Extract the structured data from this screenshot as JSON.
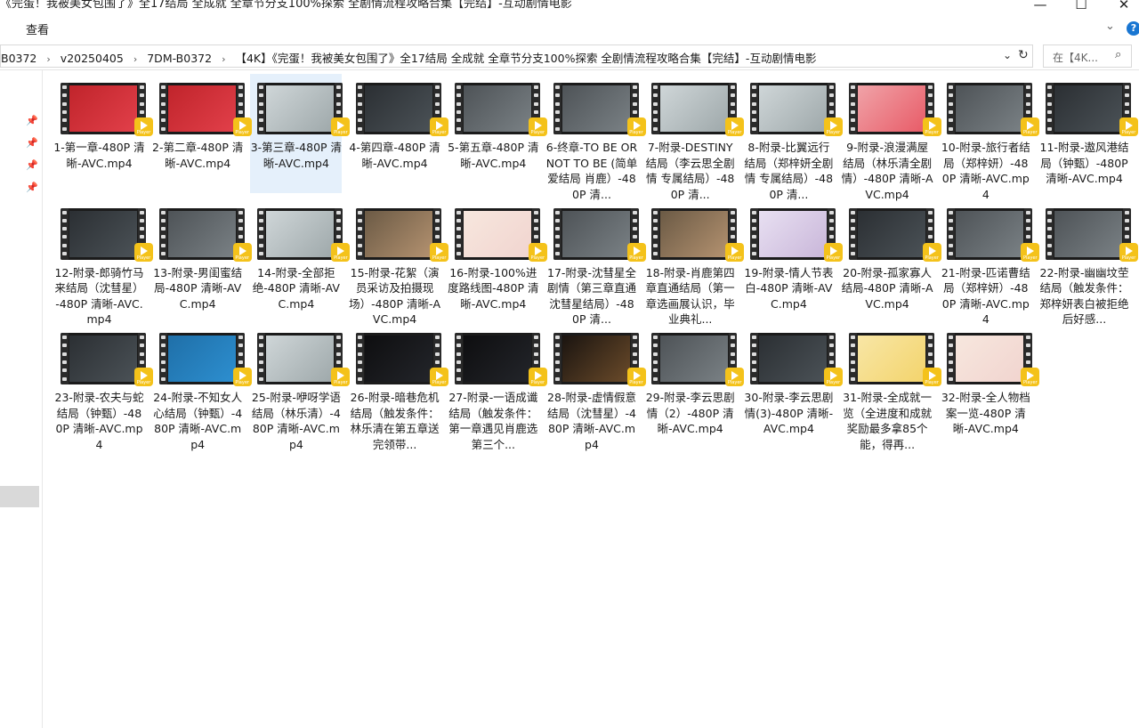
{
  "window": {
    "title": "《完蛋！我被美女包围了》全17结局  全成就  全章节分支100%探索  全剧情流程攻略合集【完结】-互动剧情电影",
    "minimize_glyph": "—",
    "maximize_glyph": "☐",
    "close_glyph": "✕"
  },
  "menu": {
    "view_label": "查看",
    "expand_glyph": "⌄",
    "help_glyph": "?"
  },
  "address": {
    "crumbs": [
      "B0372",
      "v20250405",
      "7DM-B0372",
      "【4K】《完蛋！我被美女包围了》全17结局   全成就   全章节分支100%探索   全剧情流程攻略合集【完结】-互动剧情电影"
    ],
    "separator": "›",
    "dropdown_glyph": "⌄",
    "refresh_glyph": "↻",
    "search_placeholder": "在【4K...",
    "search_glyph": "⌕"
  },
  "nav": {
    "pin_glyph": "📌"
  },
  "badge_text": "Player",
  "files": [
    {
      "name": "1-第一章-480P 清晰-AVC.mp4",
      "thumb": "red"
    },
    {
      "name": "2-第二章-480P 清晰-AVC.mp4",
      "thumb": "red"
    },
    {
      "name": "3-第三章-480P 清晰-AVC.mp4",
      "thumb": "light",
      "selected": true
    },
    {
      "name": "4-第四章-480P 清晰-AVC.mp4",
      "thumb": "dark"
    },
    {
      "name": "5-第五章-480P 清晰-AVC.mp4",
      "thumb": "grey"
    },
    {
      "name": "6-终章-TO BE OR NOT TO BE (简单爱结局  肖鹿）-480P 清...",
      "thumb": "grey"
    },
    {
      "name": "7-附录-DESTINY 结局（李云思全剧情  专属结局）-480P 清...",
      "thumb": "light"
    },
    {
      "name": "8-附录-比翼远行结局（郑梓妍全剧情  专属结局）-480P 清...",
      "thumb": "light"
    },
    {
      "name": "9-附录-浪漫满屋结局（林乐清全剧情）-480P 清晰-AVC.mp4",
      "thumb": "pink"
    },
    {
      "name": "10-附录-旅行者结局（郑梓妍）-480P 清晰-AVC.mp4",
      "thumb": "grey"
    },
    {
      "name": "11-附录-遨风港结局（钟甄）-480P 清晰-AVC.mp4",
      "thumb": "dark"
    },
    {
      "name": "12-附录-郎骑竹马来结局（沈彗星）-480P 清晰-AVC.mp4",
      "thumb": "dark"
    },
    {
      "name": "13-附录-男闺蜜结局-480P 清晰-AVC.mp4",
      "thumb": "grey"
    },
    {
      "name": "14-附录-全部拒绝-480P 清晰-AVC.mp4",
      "thumb": "light"
    },
    {
      "name": "15-附录-花絮（演员采访及拍摄现场）-480P 清晰-AVC.mp4",
      "thumb": "warm"
    },
    {
      "name": "16-附录-100%进度路线图-480P 清晰-AVC.mp4",
      "thumb": "pastel"
    },
    {
      "name": "17-附录-沈彗星全剧情（第三章直通沈彗星结局）-480P 清...",
      "thumb": "grey"
    },
    {
      "name": "18-附录-肖鹿第四章直通结局（第一章选画展认识，毕业典礼...",
      "thumb": "warm"
    },
    {
      "name": "19-附录-情人节表白-480P 清晰-AVC.mp4",
      "thumb": "lavender"
    },
    {
      "name": "20-附录-孤家寡人结局-480P 清晰-AVC.mp4",
      "thumb": "dark"
    },
    {
      "name": "21-附录-匹诺曹结局（郑梓妍）-480P 清晰-AVC.mp4",
      "thumb": "grey"
    },
    {
      "name": "22-附录-幽幽坟茔结局（触发条件：郑梓妍表白被拒绝后好感...",
      "thumb": "grey"
    },
    {
      "name": "23-附录-农夫与蛇结局（钟甄）-480P 清晰-AVC.mp4",
      "thumb": "dark"
    },
    {
      "name": "24-附录-不知女人心结局（钟甄）-480P 清晰-AVC.mp4",
      "thumb": "blue"
    },
    {
      "name": "25-附录-咿呀学语结局（林乐清）-480P 清晰-AVC.mp4",
      "thumb": "light"
    },
    {
      "name": "26-附录-暗巷危机结局（触发条件：林乐清在第五章送完领带...",
      "thumb": "black"
    },
    {
      "name": "27-附录-一语成谶结局（触发条件：第一章遇见肖鹿选第三个...",
      "thumb": "black"
    },
    {
      "name": "28-附录-虚情假意结局（沈彗星）-480P 清晰-AVC.mp4",
      "thumb": "warmdark"
    },
    {
      "name": "29-附录-李云思剧情（2）-480P 清晰-AVC.mp4",
      "thumb": "grey"
    },
    {
      "name": "30-附录-李云思剧情(3)-480P 清晰-AVC.mp4",
      "thumb": "dark"
    },
    {
      "name": "31-附录-全成就一览（全进度和成就奖励最多拿85个能，得再...",
      "thumb": "yellow"
    },
    {
      "name": "32-附录-全人物档案一览-480P 清晰-AVC.mp4",
      "thumb": "pastel"
    }
  ]
}
